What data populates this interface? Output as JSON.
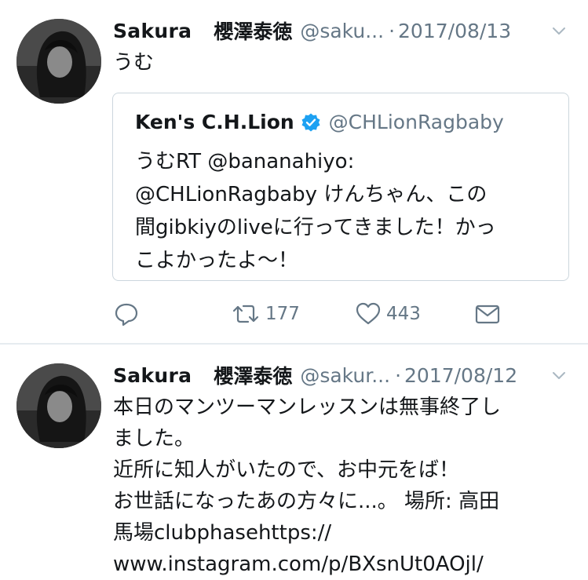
{
  "tweets": [
    {
      "author": {
        "name": "Sakura",
        "display_kanji": "櫻澤泰徳",
        "handle": "@saku...",
        "avatar": "avatar-photo"
      },
      "separator": "·",
      "date": "2017/08/13",
      "text": "うむ",
      "quote": {
        "name": "Ken's C.H.Lion",
        "verified": true,
        "handle": "@CHLionRagbaby",
        "lines": [
          "うむRT @bananahiyo:",
          "@CHLionRagbaby けんちゃん、この",
          "間gibkiyのliveに行ってきました！かっ",
          "こよかったよ〜！"
        ]
      },
      "actions": {
        "reply_icon": "reply-icon",
        "retweet_icon": "retweet-icon",
        "retweet_count": "177",
        "like_icon": "heart-icon",
        "like_count": "443",
        "dm_icon": "envelope-icon"
      }
    },
    {
      "author": {
        "name": "Sakura",
        "display_kanji": "櫻澤泰徳",
        "handle": "@sakur...",
        "avatar": "avatar-photo"
      },
      "separator": "·",
      "date": "2017/08/12",
      "lines": [
        "本日のマンツーマンレッスンは無事終了し",
        "ました。",
        "近所に知人がいたので、お中元をば！",
        "お世話になったあの方々に...。 場所: 高田",
        "馬場clubphasehttps://",
        "www.instagram.com/p/BXsnUt0AOjl/"
      ]
    }
  ],
  "colors": {
    "text": "#14171a",
    "muted": "#657786",
    "verified": "#1da1f2",
    "border": "#ccd6dd",
    "divider": "#e6ecf0"
  }
}
